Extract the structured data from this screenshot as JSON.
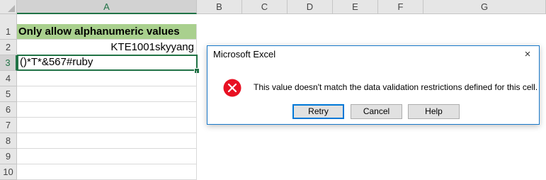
{
  "columns": [
    "A",
    "B",
    "C",
    "D",
    "E",
    "F",
    "G"
  ],
  "rows": [
    "1",
    "2",
    "3",
    "4",
    "5",
    "6",
    "7",
    "8",
    "9",
    "10"
  ],
  "active_column": "A",
  "active_row": "3",
  "cells": {
    "A1": "Only allow alphanumeric values",
    "A2": "KTE1001skyyang",
    "A3": "()*T*&567#ruby"
  },
  "colors": {
    "title_fill": "#a9d08e",
    "selection": "#217346",
    "error_icon": "#e81123",
    "dialog_border": "#1979ca"
  },
  "dialog": {
    "title": "Microsoft Excel",
    "close_icon": "×",
    "icon": "error-icon",
    "message": "This value doesn't match the data validation restrictions defined for this cell.",
    "buttons": {
      "retry": "Retry",
      "cancel": "Cancel",
      "help": "Help"
    }
  }
}
